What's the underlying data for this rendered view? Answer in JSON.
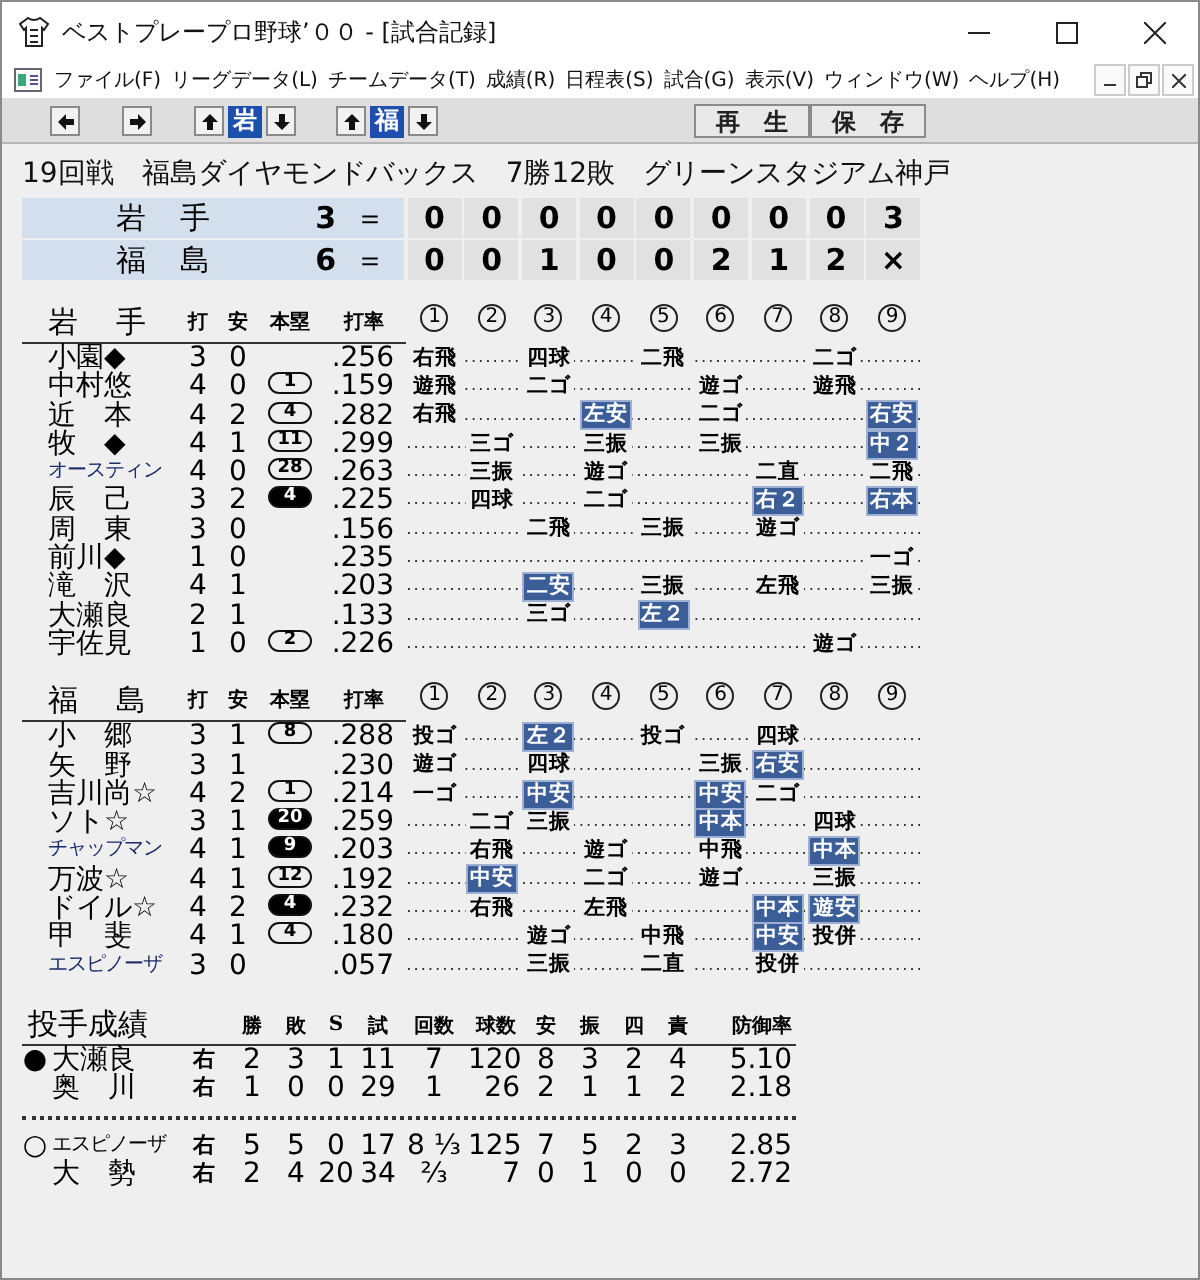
{
  "window": {
    "title": "ベストプレープロ野球’００ - [試合記録]"
  },
  "menu": [
    "ファイル(F)",
    "リーグデータ(L)",
    "チームデータ(T)",
    "成績(R)",
    "日程表(S)",
    "試合(G)",
    "表示(V)",
    "ウィンドウ(W)",
    "ヘルプ(H)"
  ],
  "toolbar": {
    "teams": [
      {
        "label": "岩"
      },
      {
        "label": "福"
      }
    ],
    "buttons": [
      "再　生",
      "保　存"
    ]
  },
  "game_info": {
    "round": "19回戦",
    "opponent": "福島ダイヤモンドバックス",
    "record": "7勝12敗",
    "stadium": "グリーンスタジアム神戸"
  },
  "scoreboard": [
    {
      "team": "岩　手",
      "total": "3",
      "equals": "＝",
      "innings": [
        "0",
        "0",
        "0",
        "0",
        "0",
        "0",
        "0",
        "0",
        "3"
      ]
    },
    {
      "team": "福　島",
      "total": "6",
      "equals": "＝",
      "innings": [
        "0",
        "0",
        "1",
        "0",
        "0",
        "2",
        "1",
        "2",
        "×"
      ]
    }
  ],
  "batting": [
    {
      "team": "岩　手",
      "columns": [
        "打",
        "安",
        "本塁",
        "打率"
      ],
      "inning_headers": [
        "1",
        "2",
        "3",
        "4",
        "5",
        "6",
        "7",
        "8",
        "9"
      ],
      "players": [
        {
          "name": "小園◆",
          "ab": "3",
          "h": "0",
          "avg": ".256",
          "at_bats": [
            {
              "kind": "result",
              "result": "右飛",
              "hit": false
            },
            {
              "kind": "empty"
            },
            {
              "kind": "result",
              "result": "四球",
              "hit": false
            },
            {
              "kind": "empty"
            },
            {
              "kind": "result",
              "result": "二飛",
              "hit": false
            },
            {
              "kind": "empty"
            },
            {
              "kind": "empty"
            },
            {
              "kind": "result",
              "result": "二ゴ",
              "hit": false
            },
            {
              "kind": "empty"
            }
          ]
        },
        {
          "name": "中村悠",
          "ab": "4",
          "h": "0",
          "hr": {
            "count": "1",
            "filled": false
          },
          "avg": ".159",
          "at_bats": [
            {
              "kind": "result",
              "result": "遊飛",
              "hit": false
            },
            {
              "kind": "empty"
            },
            {
              "kind": "result",
              "result": "二ゴ",
              "hit": false
            },
            {
              "kind": "empty"
            },
            {
              "kind": "empty"
            },
            {
              "kind": "result",
              "result": "遊ゴ",
              "hit": false
            },
            {
              "kind": "empty"
            },
            {
              "kind": "result",
              "result": "遊飛",
              "hit": false
            },
            {
              "kind": "empty"
            }
          ]
        },
        {
          "name": "近　本",
          "ab": "4",
          "h": "2",
          "hr": {
            "count": "4",
            "filled": false
          },
          "avg": ".282",
          "at_bats": [
            {
              "kind": "result",
              "result": "右飛",
              "hit": false
            },
            {
              "kind": "empty"
            },
            {
              "kind": "empty"
            },
            {
              "kind": "result",
              "result": "左安",
              "hit": true
            },
            {
              "kind": "empty"
            },
            {
              "kind": "result",
              "result": "二ゴ",
              "hit": false
            },
            {
              "kind": "empty"
            },
            {
              "kind": "empty"
            },
            {
              "kind": "result",
              "result": "右安",
              "hit": true
            }
          ]
        },
        {
          "name": "牧　◆",
          "ab": "4",
          "h": "1",
          "hr": {
            "count": "11",
            "filled": false
          },
          "avg": ".299",
          "at_bats": [
            {
              "kind": "empty"
            },
            {
              "kind": "result",
              "result": "三ゴ",
              "hit": false
            },
            {
              "kind": "empty"
            },
            {
              "kind": "result",
              "result": "三振",
              "hit": false
            },
            {
              "kind": "empty"
            },
            {
              "kind": "result",
              "result": "三振",
              "hit": false
            },
            {
              "kind": "empty"
            },
            {
              "kind": "empty"
            },
            {
              "kind": "result",
              "result": "中２",
              "hit": true
            }
          ]
        },
        {
          "name": "オースティン",
          "ab": "4",
          "h": "0",
          "hr": {
            "count": "28",
            "filled": false
          },
          "avg": ".263",
          "at_bats": [
            {
              "kind": "empty"
            },
            {
              "kind": "result",
              "result": "三振",
              "hit": false
            },
            {
              "kind": "empty"
            },
            {
              "kind": "result",
              "result": "遊ゴ",
              "hit": false
            },
            {
              "kind": "empty"
            },
            {
              "kind": "empty"
            },
            {
              "kind": "result",
              "result": "二直",
              "hit": false
            },
            {
              "kind": "empty"
            },
            {
              "kind": "result",
              "result": "二飛",
              "hit": false
            }
          ]
        },
        {
          "name": "辰　己",
          "ab": "3",
          "h": "2",
          "hr": {
            "count": "4",
            "filled": true
          },
          "avg": ".225",
          "at_bats": [
            {
              "kind": "empty"
            },
            {
              "kind": "result",
              "result": "四球",
              "hit": false
            },
            {
              "kind": "empty"
            },
            {
              "kind": "result",
              "result": "二ゴ",
              "hit": false
            },
            {
              "kind": "empty"
            },
            {
              "kind": "empty"
            },
            {
              "kind": "result",
              "result": "右２",
              "hit": true
            },
            {
              "kind": "empty"
            },
            {
              "kind": "result",
              "result": "右本",
              "hit": true
            }
          ]
        },
        {
          "name": "周　東",
          "ab": "3",
          "h": "0",
          "avg": ".156",
          "at_bats": [
            {
              "kind": "empty"
            },
            {
              "kind": "empty"
            },
            {
              "kind": "result",
              "result": "二飛",
              "hit": false
            },
            {
              "kind": "empty"
            },
            {
              "kind": "result",
              "result": "三振",
              "hit": false
            },
            {
              "kind": "empty"
            },
            {
              "kind": "result",
              "result": "遊ゴ",
              "hit": false
            },
            {
              "kind": "empty"
            },
            {
              "kind": "empty"
            }
          ]
        },
        {
          "name": "前川◆",
          "ab": "1",
          "h": "0",
          "avg": ".235",
          "at_bats": [
            {
              "kind": "empty"
            },
            {
              "kind": "empty"
            },
            {
              "kind": "empty"
            },
            {
              "kind": "empty"
            },
            {
              "kind": "empty"
            },
            {
              "kind": "empty"
            },
            {
              "kind": "empty"
            },
            {
              "kind": "empty"
            },
            {
              "kind": "result",
              "result": "一ゴ",
              "hit": false
            }
          ]
        },
        {
          "name": "滝　沢",
          "ab": "4",
          "h": "1",
          "avg": ".203",
          "at_bats": [
            {
              "kind": "empty"
            },
            {
              "kind": "empty"
            },
            {
              "kind": "result",
              "result": "二安",
              "hit": true
            },
            {
              "kind": "empty"
            },
            {
              "kind": "result",
              "result": "三振",
              "hit": false
            },
            {
              "kind": "empty"
            },
            {
              "kind": "result",
              "result": "左飛",
              "hit": false
            },
            {
              "kind": "empty"
            },
            {
              "kind": "result",
              "result": "三振",
              "hit": false
            }
          ]
        },
        {
          "name": "大瀬良",
          "ab": "2",
          "h": "1",
          "avg": ".133",
          "at_bats": [
            {
              "kind": "empty"
            },
            {
              "kind": "empty"
            },
            {
              "kind": "result",
              "result": "三ゴ",
              "hit": false
            },
            {
              "kind": "empty"
            },
            {
              "kind": "result",
              "result": "左２",
              "hit": true
            },
            {
              "kind": "empty"
            },
            {
              "kind": "empty"
            },
            {
              "kind": "empty"
            },
            {
              "kind": "empty"
            }
          ]
        },
        {
          "name": "宇佐見",
          "ab": "1",
          "h": "0",
          "hr": {
            "count": "2",
            "filled": false
          },
          "avg": ".226",
          "at_bats": [
            {
              "kind": "empty"
            },
            {
              "kind": "empty"
            },
            {
              "kind": "empty"
            },
            {
              "kind": "empty"
            },
            {
              "kind": "empty"
            },
            {
              "kind": "empty"
            },
            {
              "kind": "empty"
            },
            {
              "kind": "result",
              "result": "遊ゴ",
              "hit": false
            },
            {
              "kind": "empty"
            }
          ]
        }
      ]
    },
    {
      "team": "福　島",
      "columns": [
        "打",
        "安",
        "本塁",
        "打率"
      ],
      "inning_headers": [
        "1",
        "2",
        "3",
        "4",
        "5",
        "6",
        "7",
        "8",
        "9"
      ],
      "players": [
        {
          "name": "小　郷",
          "ab": "3",
          "h": "1",
          "hr": {
            "count": "8",
            "filled": false
          },
          "avg": ".288",
          "at_bats": [
            {
              "kind": "result",
              "result": "投ゴ",
              "hit": false
            },
            {
              "kind": "empty"
            },
            {
              "kind": "result",
              "result": "左２",
              "hit": true
            },
            {
              "kind": "empty"
            },
            {
              "kind": "result",
              "result": "投ゴ",
              "hit": false
            },
            {
              "kind": "empty"
            },
            {
              "kind": "result",
              "result": "四球",
              "hit": false
            },
            {
              "kind": "empty"
            },
            {
              "kind": "empty"
            }
          ]
        },
        {
          "name": "矢　野",
          "ab": "3",
          "h": "1",
          "avg": ".230",
          "at_bats": [
            {
              "kind": "result",
              "result": "遊ゴ",
              "hit": false
            },
            {
              "kind": "empty"
            },
            {
              "kind": "result",
              "result": "四球",
              "hit": false
            },
            {
              "kind": "empty"
            },
            {
              "kind": "empty"
            },
            {
              "kind": "result",
              "result": "三振",
              "hit": false
            },
            {
              "kind": "result",
              "result": "右安",
              "hit": true
            },
            {
              "kind": "empty"
            },
            {
              "kind": "empty"
            }
          ]
        },
        {
          "name": "吉川尚☆",
          "ab": "4",
          "h": "2",
          "hr": {
            "count": "1",
            "filled": false
          },
          "avg": ".214",
          "at_bats": [
            {
              "kind": "result",
              "result": "一ゴ",
              "hit": false
            },
            {
              "kind": "empty"
            },
            {
              "kind": "result",
              "result": "中安",
              "hit": true
            },
            {
              "kind": "empty"
            },
            {
              "kind": "empty"
            },
            {
              "kind": "result",
              "result": "中安",
              "hit": true
            },
            {
              "kind": "result",
              "result": "二ゴ",
              "hit": false
            },
            {
              "kind": "empty"
            },
            {
              "kind": "empty"
            }
          ]
        },
        {
          "name": "ソト☆",
          "ab": "3",
          "h": "1",
          "hr": {
            "count": "20",
            "filled": true
          },
          "avg": ".259",
          "at_bats": [
            {
              "kind": "empty"
            },
            {
              "kind": "result",
              "result": "二ゴ",
              "hit": false
            },
            {
              "kind": "result",
              "result": "三振",
              "hit": false
            },
            {
              "kind": "empty"
            },
            {
              "kind": "empty"
            },
            {
              "kind": "result",
              "result": "中本",
              "hit": true
            },
            {
              "kind": "empty"
            },
            {
              "kind": "result",
              "result": "四球",
              "hit": false
            },
            {
              "kind": "empty"
            }
          ]
        },
        {
          "name": "チャップマン",
          "ab": "4",
          "h": "1",
          "hr": {
            "count": "9",
            "filled": true
          },
          "avg": ".203",
          "at_bats": [
            {
              "kind": "empty"
            },
            {
              "kind": "result",
              "result": "右飛",
              "hit": false
            },
            {
              "kind": "empty"
            },
            {
              "kind": "result",
              "result": "遊ゴ",
              "hit": false
            },
            {
              "kind": "empty"
            },
            {
              "kind": "result",
              "result": "中飛",
              "hit": false
            },
            {
              "kind": "empty"
            },
            {
              "kind": "result",
              "result": "中本",
              "hit": true
            },
            {
              "kind": "empty"
            }
          ]
        },
        {
          "name": "万波☆",
          "ab": "4",
          "h": "1",
          "hr": {
            "count": "12",
            "filled": false
          },
          "avg": ".192",
          "at_bats": [
            {
              "kind": "empty"
            },
            {
              "kind": "result",
              "result": "中安",
              "hit": true
            },
            {
              "kind": "empty"
            },
            {
              "kind": "result",
              "result": "二ゴ",
              "hit": false
            },
            {
              "kind": "empty"
            },
            {
              "kind": "result",
              "result": "遊ゴ",
              "hit": false
            },
            {
              "kind": "empty"
            },
            {
              "kind": "result",
              "result": "三振",
              "hit": false
            },
            {
              "kind": "empty"
            }
          ]
        },
        {
          "name": "ドイル☆",
          "ab": "4",
          "h": "2",
          "hr": {
            "count": "4",
            "filled": true
          },
          "avg": ".232",
          "at_bats": [
            {
              "kind": "empty"
            },
            {
              "kind": "result",
              "result": "右飛",
              "hit": false
            },
            {
              "kind": "empty"
            },
            {
              "kind": "result",
              "result": "左飛",
              "hit": false
            },
            {
              "kind": "empty"
            },
            {
              "kind": "empty"
            },
            {
              "kind": "result",
              "result": "中本",
              "hit": true
            },
            {
              "kind": "result",
              "result": "遊安",
              "hit": true
            },
            {
              "kind": "empty"
            }
          ]
        },
        {
          "name": "甲　斐",
          "ab": "4",
          "h": "1",
          "hr": {
            "count": "4",
            "filled": false
          },
          "avg": ".180",
          "at_bats": [
            {
              "kind": "empty"
            },
            {
              "kind": "empty"
            },
            {
              "kind": "result",
              "result": "遊ゴ",
              "hit": false
            },
            {
              "kind": "empty"
            },
            {
              "kind": "result",
              "result": "中飛",
              "hit": false
            },
            {
              "kind": "empty"
            },
            {
              "kind": "result",
              "result": "中安",
              "hit": true
            },
            {
              "kind": "result",
              "result": "投併",
              "hit": false
            },
            {
              "kind": "empty"
            }
          ]
        },
        {
          "name": "エスピノーザ",
          "ab": "3",
          "h": "0",
          "avg": ".057",
          "at_bats": [
            {
              "kind": "empty"
            },
            {
              "kind": "empty"
            },
            {
              "kind": "result",
              "result": "三振",
              "hit": false
            },
            {
              "kind": "empty"
            },
            {
              "kind": "result",
              "result": "二直",
              "hit": false
            },
            {
              "kind": "empty"
            },
            {
              "kind": "result",
              "result": "投併",
              "hit": false
            },
            {
              "kind": "empty"
            },
            {
              "kind": "empty"
            }
          ]
        }
      ]
    }
  ],
  "pitching": {
    "title": "投手成績",
    "columns": [
      "勝",
      "敗",
      "S",
      "試",
      "回数",
      "球数",
      "安",
      "振",
      "四",
      "責",
      "防御率"
    ],
    "groups": [
      {
        "pitchers": [
          {
            "mark": "●",
            "name": "大瀬良",
            "hand": "右",
            "stats": [
              "2",
              "3",
              "1",
              "11",
              "7",
              "120",
              "8",
              "3",
              "2",
              "4",
              "5.10"
            ]
          },
          {
            "name": "奥　川",
            "hand": "右",
            "stats": [
              "1",
              "0",
              "0",
              "29",
              "1",
              "26",
              "2",
              "1",
              "1",
              "2",
              "2.18"
            ]
          }
        ]
      },
      {
        "pitchers": [
          {
            "mark": "○",
            "name": "エスピノーザ",
            "hand": "右",
            "stats": [
              "5",
              "5",
              "0",
              "17",
              "8 ⅓",
              "125",
              "7",
              "5",
              "2",
              "3",
              "2.85"
            ]
          },
          {
            "name": "大　勢",
            "hand": "右",
            "stats": [
              "2",
              "4",
              "20",
              "34",
              "⅔",
              "7",
              "0",
              "1",
              "0",
              "0",
              "2.72"
            ]
          }
        ]
      }
    ]
  }
}
